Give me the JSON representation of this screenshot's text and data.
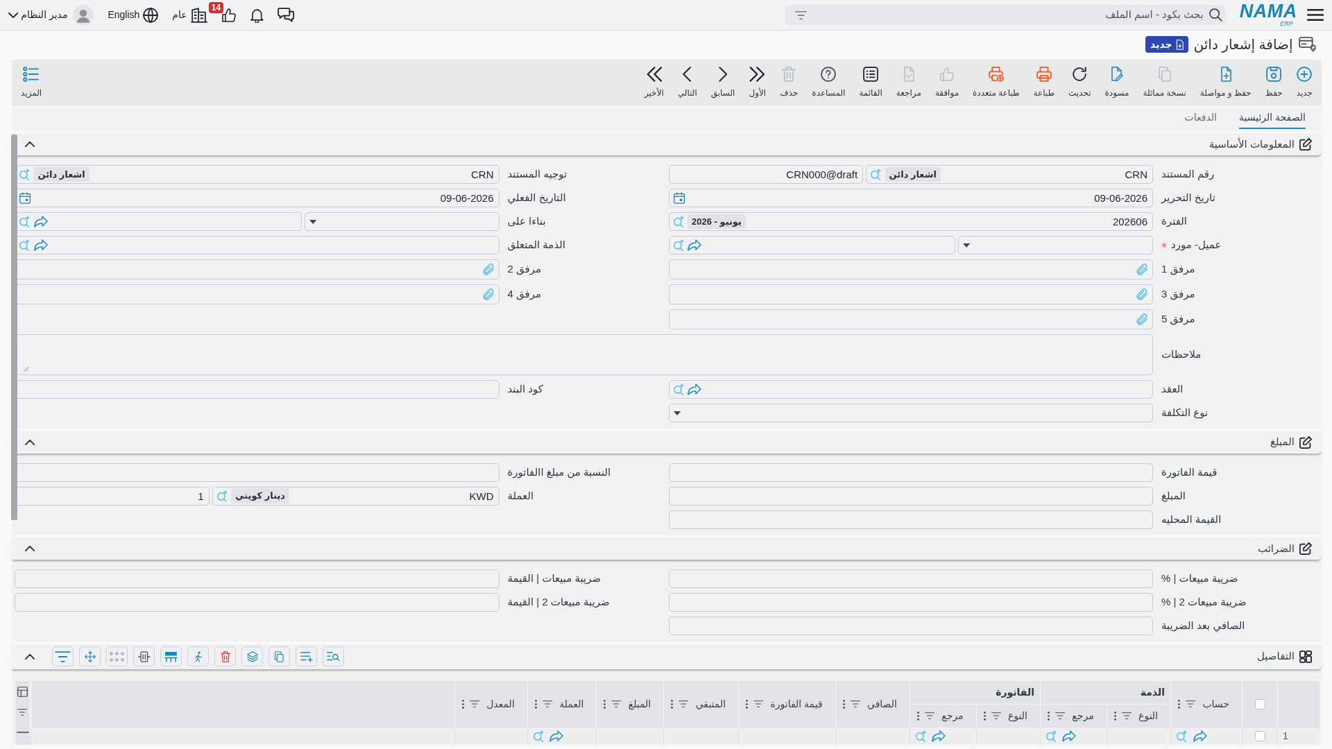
{
  "topbar": {
    "logo": {
      "wordmark": "NAMA",
      "tagline": "ERP"
    },
    "search": {
      "placeholder": "بحث بكود - اسم الملف"
    },
    "approvals_badge": "14",
    "company": "عام",
    "language": "English",
    "user": "مدير النظام"
  },
  "page_header": {
    "title": "إضافة إشعار دائن",
    "status": "جديد"
  },
  "toolbar": {
    "buttons": [
      {
        "kind": "new",
        "label": "جديد",
        "disabled": false
      },
      {
        "kind": "save",
        "label": "حفظ",
        "disabled": false
      },
      {
        "kind": "save_continue",
        "label": "حفظ و مواصلة",
        "disabled": false
      },
      {
        "kind": "duplicate",
        "label": "نسخة مماثلة",
        "disabled": true
      },
      {
        "kind": "draft",
        "label": "مسودة",
        "disabled": false
      },
      {
        "kind": "refresh",
        "label": "تحديث",
        "disabled": false
      },
      {
        "kind": "print",
        "label": "طباعة",
        "disabled": false
      },
      {
        "kind": "multi_print",
        "label": "طباعة متعددة",
        "disabled": false
      },
      {
        "kind": "approve",
        "label": "موافقة",
        "disabled": true
      },
      {
        "kind": "review",
        "label": "مراجعة",
        "disabled": true
      },
      {
        "kind": "list",
        "label": "القائمة",
        "disabled": false
      },
      {
        "kind": "help",
        "label": "المساعدة",
        "disabled": false
      },
      {
        "kind": "delete",
        "label": "حذف",
        "disabled": true
      },
      {
        "kind": "first",
        "label": "الأول",
        "disabled": false
      },
      {
        "kind": "previous",
        "label": "السابق",
        "disabled": false
      },
      {
        "kind": "next",
        "label": "التالي",
        "disabled": false
      },
      {
        "kind": "last",
        "label": "الأخير",
        "disabled": false
      }
    ],
    "more": {
      "label": "المزيد"
    }
  },
  "tabs": [
    {
      "label": "الصفحة الرئيسية",
      "selected": true
    },
    {
      "label": "الدفعات",
      "selected": false
    }
  ],
  "sections": [
    {
      "kind": "form",
      "title": "المعلومات الأساسية",
      "expanded": true,
      "rows": [
        [
          {
            "label": "رقم المستند",
            "required": false,
            "inputs": [
              {
                "kind": "lookup",
                "value": "CRN",
                "chip": "اشعار دائن",
                "link": false
              },
              {
                "kind": "text",
                "value": "CRN000@draft"
              }
            ]
          },
          {
            "label": "توجيه المستند",
            "required": false,
            "inputs": [
              {
                "kind": "lookup",
                "value": "CRN",
                "chip": "اشعار دائن",
                "link": false
              }
            ]
          }
        ],
        [
          {
            "label": "تاريخ التحرير",
            "required": false,
            "inputs": [
              {
                "kind": "date",
                "value": "09-06-2026"
              }
            ]
          },
          {
            "label": "التاريخ الفعلي",
            "required": false,
            "inputs": [
              {
                "kind": "date",
                "value": "09-06-2026"
              }
            ]
          }
        ],
        [
          {
            "label": "الفترة",
            "required": false,
            "inputs": [
              {
                "kind": "lookup",
                "value": "202606",
                "chip": "يونيو - 2026",
                "link": false
              }
            ]
          },
          {
            "label": "بناءا على",
            "required": false,
            "inputs": [
              {
                "kind": "select"
              },
              {
                "kind": "lookup",
                "link": true
              }
            ]
          }
        ],
        [
          {
            "label": "عميل- مورد",
            "required": true,
            "inputs": [
              {
                "kind": "select"
              },
              {
                "kind": "lookup",
                "link": true
              }
            ]
          },
          {
            "label": "الذمة المتعلق",
            "required": false,
            "inputs": [
              {
                "kind": "lookup",
                "link": true
              }
            ]
          }
        ],
        [
          {
            "label": "مرفق 1",
            "required": false,
            "inputs": [
              {
                "kind": "file"
              }
            ]
          },
          {
            "label": "مرفق 2",
            "required": false,
            "inputs": [
              {
                "kind": "file"
              }
            ]
          }
        ],
        [
          {
            "label": "مرفق 3",
            "required": false,
            "inputs": [
              {
                "kind": "file"
              }
            ]
          },
          {
            "label": "مرفق 4",
            "required": false,
            "inputs": [
              {
                "kind": "file"
              }
            ]
          }
        ],
        [
          {
            "label": "مرفق 5",
            "required": false,
            "inputs": [
              {
                "kind": "file"
              }
            ]
          }
        ],
        [
          {
            "label": "ملاحظات",
            "required": false,
            "inputs": [
              {
                "kind": "textarea"
              }
            ]
          }
        ],
        [
          {
            "label": "العقد",
            "required": false,
            "inputs": [
              {
                "kind": "lookup",
                "link": true
              }
            ]
          },
          {
            "label": "كود البند",
            "required": false,
            "inputs": [
              {
                "kind": "text"
              }
            ]
          }
        ],
        [
          {
            "label": "نوع التكلفة",
            "required": false,
            "inputs": [
              {
                "kind": "select"
              }
            ]
          }
        ]
      ]
    },
    {
      "kind": "form",
      "title": "المبلغ",
      "expanded": true,
      "rows": [
        [
          {
            "label": "قيمة الفاتورة",
            "required": false,
            "inputs": [
              {
                "kind": "text"
              }
            ]
          },
          {
            "label": "النسبة من مبلغ االفاتورة",
            "required": false,
            "inputs": [
              {
                "kind": "text"
              }
            ]
          }
        ],
        [
          {
            "label": "المبلغ",
            "required": false,
            "inputs": [
              {
                "kind": "text"
              }
            ]
          },
          {
            "label": "العملة",
            "required": false,
            "inputs": [
              {
                "kind": "lookup",
                "value": "KWD",
                "chip": "دينار كويتي",
                "link": false
              },
              {
                "kind": "text",
                "value": "1"
              }
            ]
          }
        ],
        [
          {
            "label": "القيمة المحليه",
            "required": false,
            "inputs": [
              {
                "kind": "text"
              }
            ]
          }
        ]
      ]
    },
    {
      "kind": "form",
      "title": "الضرائب",
      "expanded": true,
      "rows": [
        [
          {
            "label": "ضريبة مبيعات | %",
            "required": false,
            "inputs": [
              {
                "kind": "text"
              }
            ]
          },
          {
            "label": "ضريبة مبيعات | القيمة",
            "required": false,
            "inputs": [
              {
                "kind": "text"
              }
            ]
          }
        ],
        [
          {
            "label": "ضريبة مبيعات 2 | %",
            "required": false,
            "inputs": [
              {
                "kind": "text"
              }
            ]
          },
          {
            "label": "ضريبة مبيعات 2 | القيمة",
            "required": false,
            "inputs": [
              {
                "kind": "text"
              }
            ]
          }
        ],
        [
          {
            "label": "الصافي بعد الضريبة",
            "required": false,
            "inputs": [
              {
                "kind": "text"
              }
            ]
          }
        ]
      ]
    },
    {
      "kind": "grid",
      "title": "التفاصيل",
      "expanded": true,
      "all_selected": false,
      "columns": [
        {
          "label": "حساب",
          "kind": "lookup"
        },
        {
          "label": "الذمة",
          "children": [
            {
              "label": "النوع",
              "kind": "text"
            },
            {
              "label": "مرجع",
              "kind": "lookup"
            }
          ]
        },
        {
          "label": "الفاتورة",
          "children": [
            {
              "label": "النوع",
              "kind": "text"
            },
            {
              "label": "مرجع",
              "kind": "lookup"
            }
          ]
        },
        {
          "label": "الصافي",
          "kind": "text"
        },
        {
          "label": "قيمة الفاتورة",
          "kind": "text"
        },
        {
          "label": "المتبقي",
          "kind": "text"
        },
        {
          "label": "المبلغ",
          "kind": "text"
        },
        {
          "label": "العملة",
          "kind": "lookup"
        },
        {
          "label": "المعدل",
          "kind": "text"
        }
      ],
      "rows": [
        {
          "number": "1",
          "selected": false
        }
      ]
    }
  ]
}
